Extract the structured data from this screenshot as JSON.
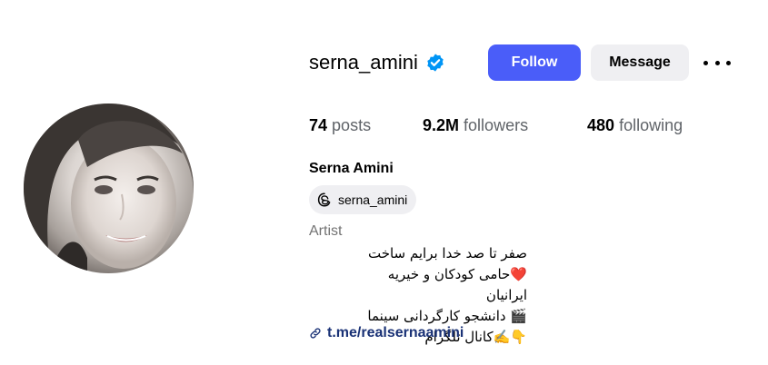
{
  "profile": {
    "username": "serna_amini",
    "verified": true,
    "full_name": "Serna Amini",
    "threads_handle": "serna_amini",
    "category": "Artist",
    "bio_lines": [
      "صفر تا صد خدا برایم ساخت",
      "❤️حامی کودکان و خیریه ایرانیان",
      "🎬 دانشجو کارگردانی سینما",
      "👇✍️کانال تلگرام"
    ],
    "link": "t.me/realsernaamini"
  },
  "actions": {
    "follow_label": "Follow",
    "message_label": "Message"
  },
  "stats": {
    "posts_count": "74",
    "posts_label": "posts",
    "followers_count": "9.2M",
    "followers_label": "followers",
    "following_count": "480",
    "following_label": "following"
  },
  "colors": {
    "follow_button": "#4a5df9",
    "secondary_button": "#efeff2",
    "verified_badge": "#0095f6",
    "link": "#1a3276",
    "muted_text": "#737373"
  },
  "icons": [
    "verified-badge-icon",
    "more-options-icon",
    "threads-icon",
    "link-icon"
  ]
}
